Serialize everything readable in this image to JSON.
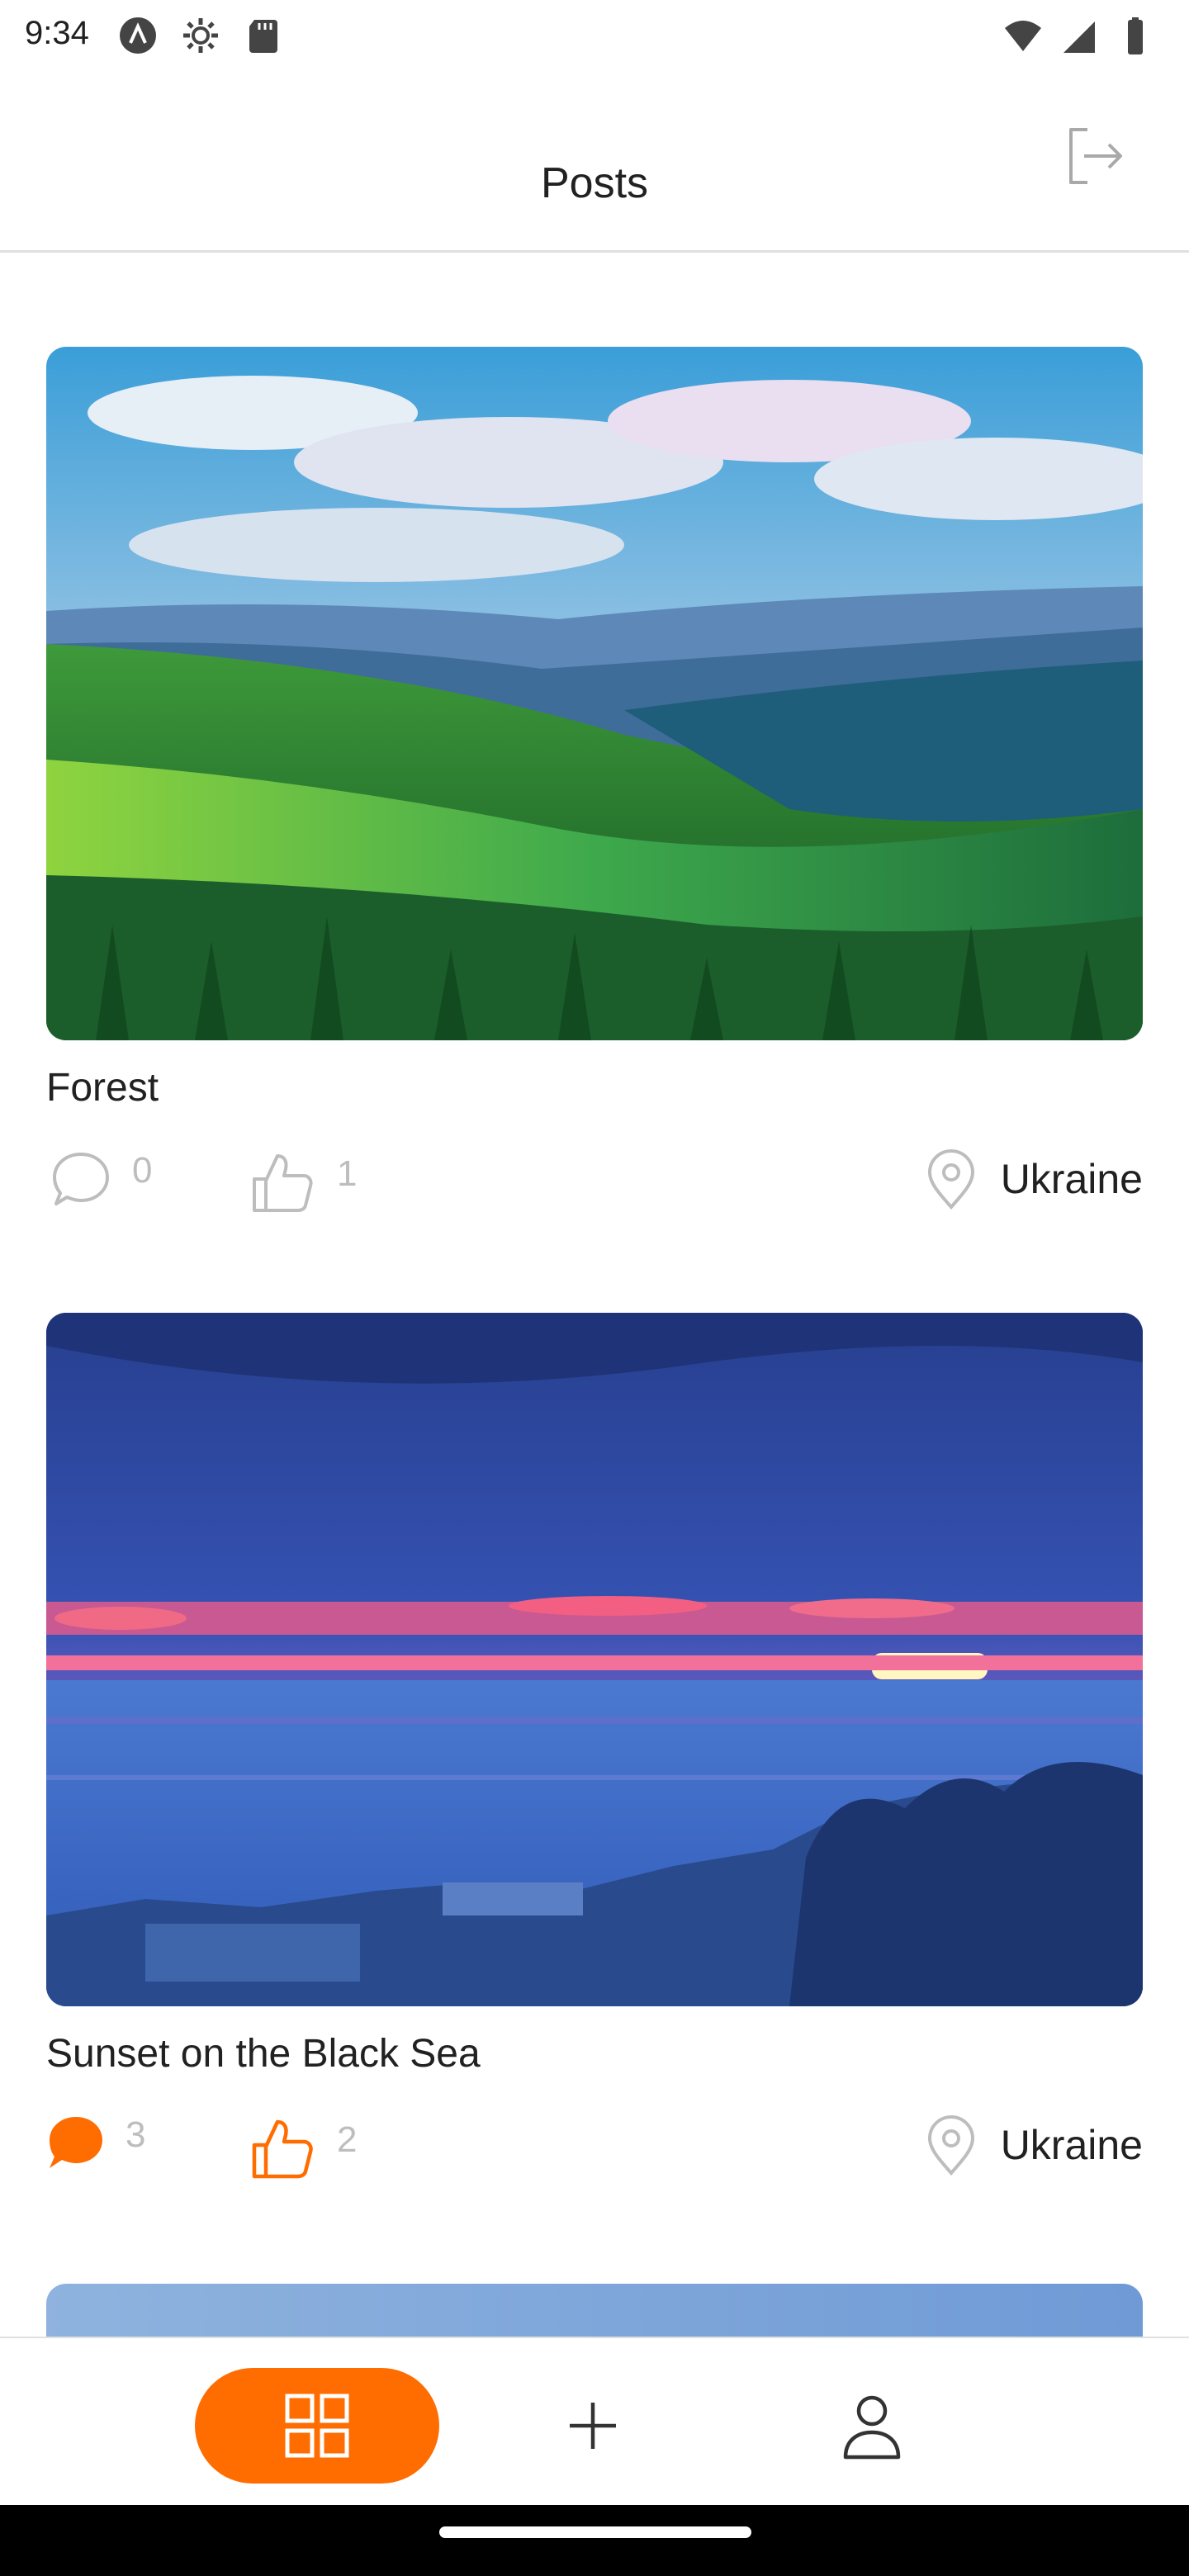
{
  "status_bar": {
    "time": "9:34",
    "left_icons": [
      "app-a-icon",
      "gear-icon",
      "sd-card-icon"
    ],
    "right_icons": [
      "wifi-icon",
      "signal-icon",
      "battery-icon"
    ]
  },
  "header": {
    "title": "Posts",
    "logout_icon": "logout-icon"
  },
  "posts": [
    {
      "title": "Forest",
      "comments_count": "0",
      "likes_count": "1",
      "location": "Ukraine",
      "has_comments": false,
      "liked": false
    },
    {
      "title": "Sunset on the Black Sea",
      "comments_count": "3",
      "likes_count": "2",
      "location": "Ukraine",
      "has_comments": true,
      "liked": true
    }
  ],
  "bottom_nav": {
    "items": [
      "grid-icon",
      "plus-icon",
      "user-icon"
    ],
    "active": "grid-icon"
  },
  "colors": {
    "accent": "#FF6C00",
    "muted": "#BDBDBD",
    "text": "#212121",
    "divider": "#E0E0E0"
  }
}
